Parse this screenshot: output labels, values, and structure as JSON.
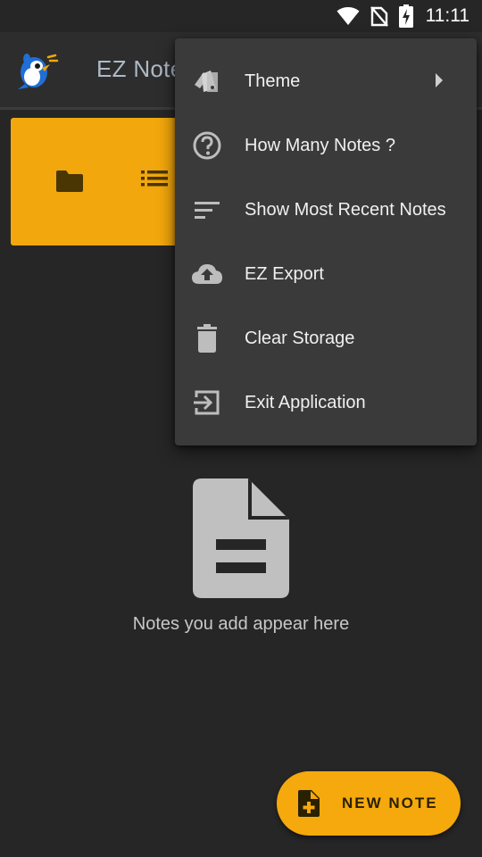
{
  "status_bar": {
    "time": "11:11",
    "icons": [
      "wifi-icon",
      "no-sim-icon",
      "battery-charging-icon"
    ]
  },
  "app": {
    "title": "EZ Notes",
    "logo_icon": "bird-logo-icon"
  },
  "folder_card": {
    "color": "#f2a70c",
    "icons": [
      "folder-icon",
      "list-view-icon"
    ]
  },
  "empty_state": {
    "icon": "document-icon",
    "message": "Notes you add appear here"
  },
  "fab": {
    "label": "NEW NOTE",
    "icon": "note-add-icon",
    "color": "#f5a90d"
  },
  "menu": {
    "items": [
      {
        "label": "Theme",
        "icon": "theme-icon",
        "has_submenu": true
      },
      {
        "label": "How Many Notes ?",
        "icon": "help-icon"
      },
      {
        "label": "Show Most Recent Notes",
        "icon": "sort-icon"
      },
      {
        "label": "EZ Export",
        "icon": "cloud-upload-icon"
      },
      {
        "label": "Clear Storage",
        "icon": "trash-icon"
      },
      {
        "label": "Exit Application",
        "icon": "exit-icon"
      }
    ]
  }
}
